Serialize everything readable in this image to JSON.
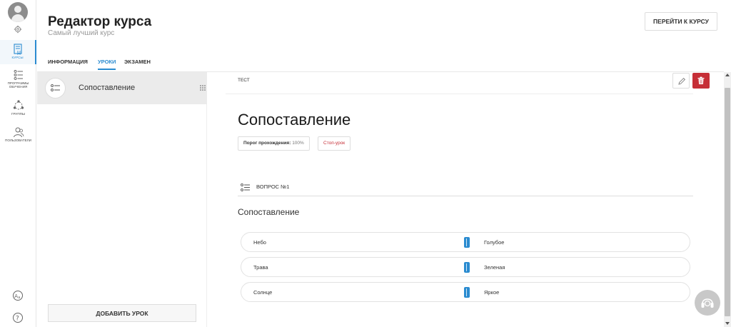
{
  "nav": {
    "items": [
      {
        "label": "КУРСЫ",
        "icon": "course-book-icon"
      },
      {
        "label": "ПРОГРАММЫ ОБУЧЕНИЯ",
        "icon": "list-icon"
      },
      {
        "label": "ГРУППЫ",
        "icon": "groups-icon"
      },
      {
        "label": "ПОЛЬЗОВАТЕЛИ",
        "icon": "users-icon"
      }
    ],
    "bottom": [
      "translate-icon",
      "help-icon"
    ]
  },
  "header": {
    "title": "Редактор курса",
    "subtitle": "Самый лучший курс",
    "go_to_course": "ПЕРЕЙТИ К КУРСУ"
  },
  "tabs": [
    {
      "label": "ИНФОРМАЦИЯ",
      "active": false
    },
    {
      "label": "УРОКИ",
      "active": true
    },
    {
      "label": "ЭКЗАМЕН",
      "active": false
    }
  ],
  "lessons": {
    "items": [
      {
        "title": "Сопоставление",
        "selected": true
      }
    ],
    "add_button": "ДОБАВИТЬ УРОК"
  },
  "lesson": {
    "type": "ТЕСТ",
    "title": "Сопоставление",
    "threshold_label": "Порог прохождения:",
    "threshold_value": "100%",
    "stop_lesson": "Стоп-урок",
    "question_label": "ВОПРОС №1",
    "question_title": "Сопоставление",
    "pairs": [
      {
        "left": "Небо",
        "right": "Голубое"
      },
      {
        "left": "Трава",
        "right": "Зеленая"
      },
      {
        "left": "Солнце",
        "right": "Яркое"
      }
    ]
  },
  "colors": {
    "accent": "#2a8bd0",
    "danger": "#c62f37",
    "selected_bg": "#ebebeb"
  }
}
